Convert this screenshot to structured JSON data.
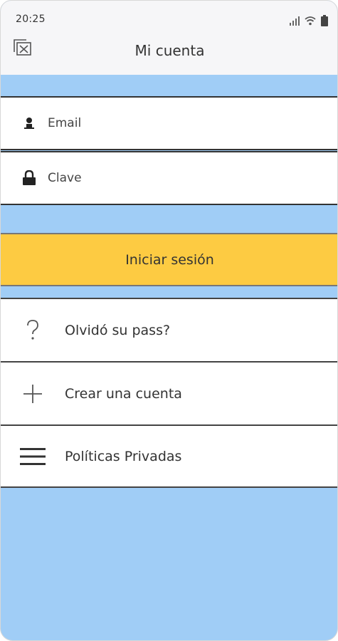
{
  "status_bar": {
    "time": "20:25"
  },
  "header": {
    "title": "Mi cuenta",
    "close_icon": "close-window-icon"
  },
  "form": {
    "email_placeholder": "Email",
    "email_icon": "user-icon",
    "password_placeholder": "Clave",
    "password_icon": "lock-icon",
    "login_label": "Iniciar sesión"
  },
  "menu": {
    "items": [
      {
        "label": "Olvidó su pass?",
        "icon": "question-icon"
      },
      {
        "label": "Crear una cuenta",
        "icon": "plus-icon"
      },
      {
        "label": "Políticas Privadas",
        "icon": "menu-lines-icon"
      }
    ]
  },
  "colors": {
    "background": "#a0cdf6",
    "button": "#fdcb42",
    "topbar": "#f6f6f8"
  }
}
